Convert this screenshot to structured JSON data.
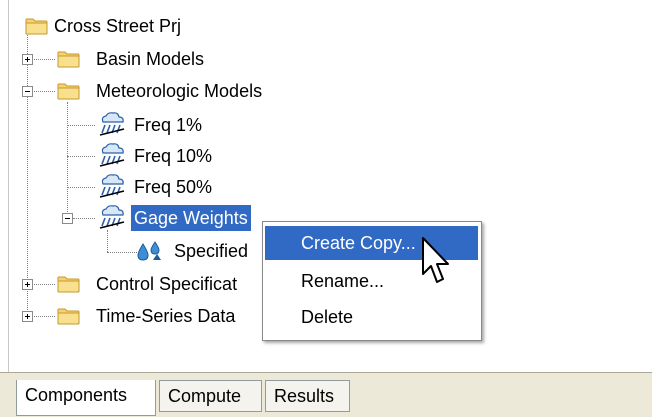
{
  "tree": {
    "root": "Cross Street Prj",
    "basin_models": "Basin Models",
    "meteorologic_models": "Meteorologic Models",
    "freq_1": "Freq 1%",
    "freq_10": "Freq 10%",
    "freq_50": "Freq 50%",
    "gage_weights": "Gage Weights",
    "specified": "Specified",
    "control_specifications": "Control Specificat",
    "time_series_data": "Time-Series Data"
  },
  "context_menu": {
    "create_copy": "Create Copy...",
    "rename": "Rename...",
    "delete": "Delete"
  },
  "tabs": {
    "components": "Components",
    "compute": "Compute",
    "results": "Results"
  },
  "icons": [
    "folder-icon",
    "meteorologic-model-icon",
    "precipitation-gage-icon",
    "mouse-cursor-icon"
  ],
  "colors": {
    "selection": "#316ac5",
    "folder": "#f3c64b",
    "tab_bar": "#ece9d8"
  }
}
